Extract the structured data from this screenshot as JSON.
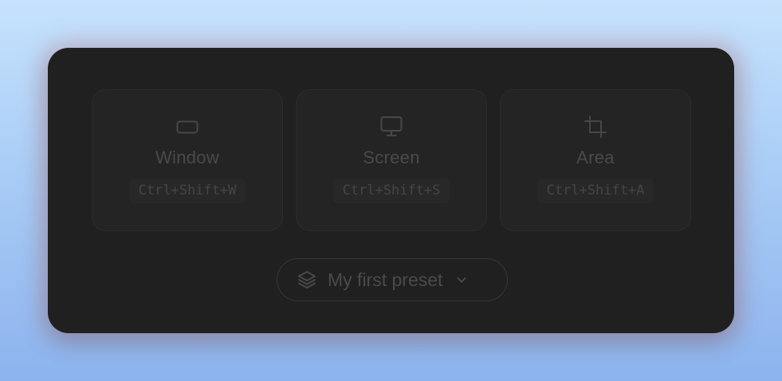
{
  "capture_modes": [
    {
      "label": "Window",
      "shortcut": "Ctrl+Shift+W",
      "icon": "window-icon"
    },
    {
      "label": "Screen",
      "shortcut": "Ctrl+Shift+S",
      "icon": "monitor-icon"
    },
    {
      "label": "Area",
      "shortcut": "Ctrl+Shift+A",
      "icon": "crop-icon"
    }
  ],
  "preset": {
    "label": "My first preset",
    "icon": "layers-icon",
    "dropdown_icon": "chevron-down-icon"
  },
  "colors": {
    "panel_background": "#202020",
    "card_background": "#242424",
    "text_muted": "#4a4a4a",
    "page_gradient_top": "#c6e2fd",
    "page_gradient_bottom": "#8db3ee"
  }
}
